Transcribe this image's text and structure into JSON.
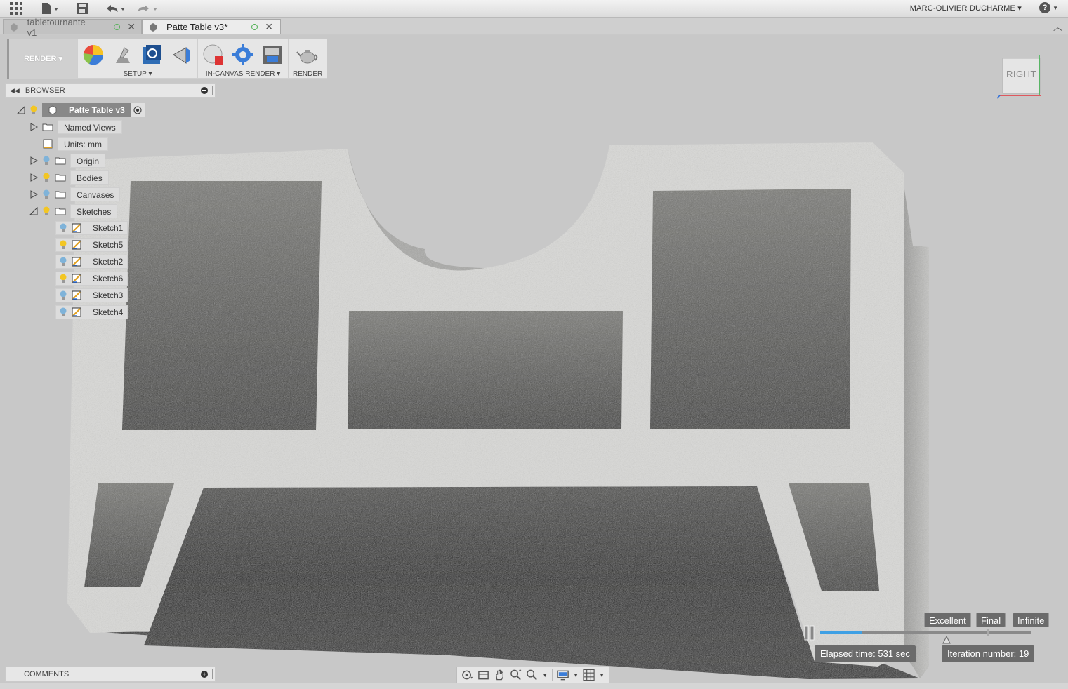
{
  "titlebar": {
    "user_name": "MARC-OLIVIER DUCHARME ▾",
    "help_label": "?"
  },
  "tabs": [
    {
      "label": "tabletournante v1",
      "active": false
    },
    {
      "label": "Patte Table v3*",
      "active": true
    }
  ],
  "toolbar": {
    "workspace": "RENDER ▾",
    "groups": [
      {
        "label": "SETUP ▾"
      },
      {
        "label": "IN-CANVAS RENDER ▾"
      },
      {
        "label": "RENDER"
      }
    ]
  },
  "viewcube": {
    "face": "RIGHT"
  },
  "browser": {
    "title": "BROWSER",
    "root": "Patte Table v3",
    "items": [
      {
        "label": "Named Views"
      },
      {
        "label": "Units: mm"
      },
      {
        "label": "Origin"
      },
      {
        "label": "Bodies"
      },
      {
        "label": "Canvases"
      },
      {
        "label": "Sketches"
      }
    ],
    "sketches": [
      {
        "label": "Sketch1"
      },
      {
        "label": "Sketch5"
      },
      {
        "label": "Sketch2"
      },
      {
        "label": "Sketch6"
      },
      {
        "label": "Sketch3"
      },
      {
        "label": "Sketch4"
      }
    ]
  },
  "render": {
    "quality_levels": [
      "Excellent",
      "Final",
      "Infinite"
    ],
    "progress": 0.2,
    "elapsed": "Elapsed time: 531 sec",
    "iteration": "Iteration number: 19"
  },
  "comments": {
    "title": "COMMENTS"
  },
  "colors": {
    "progress": "#3fa0e4",
    "bulb_on": "#f3c623",
    "bulb_off": "#7fb3d9",
    "sync": "#4caf50"
  }
}
